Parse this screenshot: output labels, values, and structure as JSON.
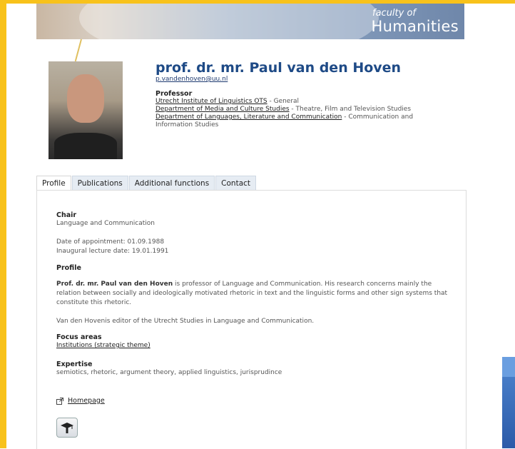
{
  "banner": {
    "faculty_of": "faculty of",
    "faculty_name": "Humanities"
  },
  "profile_header": {
    "name": "prof. dr. mr. Paul van den Hoven",
    "email": "p.vandenhoven@uu.nl",
    "role": "Professor",
    "affiliations": [
      {
        "link": "Utrecht Institute of Linguistics OTS",
        "suffix": " - General"
      },
      {
        "link": "Department of Media and Culture Studies",
        "suffix": " - Theatre, Film and Television Studies"
      },
      {
        "link": "Department of Languages, Literature and Communication",
        "suffix": " - Communication and Information Studies"
      }
    ]
  },
  "tabs": [
    {
      "label": "Profile",
      "active": true
    },
    {
      "label": "Publications",
      "active": false
    },
    {
      "label": "Additional functions",
      "active": false
    },
    {
      "label": "Contact",
      "active": false
    }
  ],
  "profile": {
    "chair_heading": "Chair",
    "chair_value": "Language and Communication",
    "appointment_date": "Date of appointment: 01.09.1988",
    "inaugural_date": "Inaugural lecture date: 19.01.1991",
    "profile_heading": "Profile",
    "profile_name": "Prof. dr. mr. Paul van den Hoven",
    "profile_text": " is professor of Language and Communication. His research concerns mainly the relation between socially and ideologically motivated rhetoric in text and the linguistic forms and other sign systems that constitute this rhetoric.",
    "editor_text": "Van den Hovenis editor of the Utrecht Studies in Language and Communication.",
    "focus_heading": "Focus areas",
    "focus_link": "Institutions (strategic theme)",
    "expertise_heading": "Expertise",
    "expertise_value": "semiotics, rhetoric, argument theory, applied linguistics, jurisprudince",
    "homepage_label": "Homepage"
  },
  "colors": {
    "frame": "#f8c21b",
    "name": "#1e4a86",
    "tab_bg": "#e6ecf3"
  },
  "icons": [
    "external-link-icon",
    "graduation-cap-icon"
  ]
}
